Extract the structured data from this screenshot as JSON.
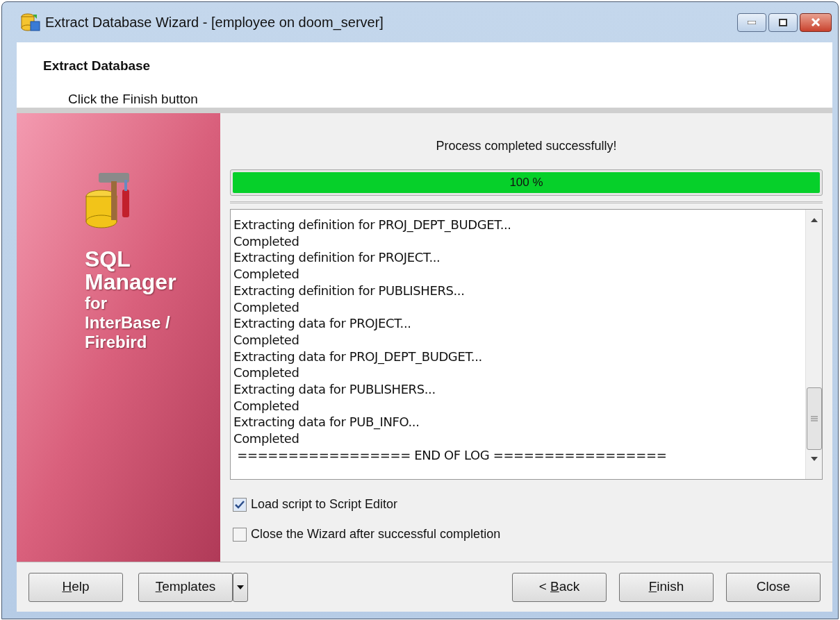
{
  "window": {
    "title": "Extract Database Wizard - [employee on doom_server]"
  },
  "header": {
    "title": "Extract Database",
    "subtitle": "Click the Finish button"
  },
  "sidebar": {
    "product": [
      "SQL",
      "Manager"
    ],
    "product_sub": [
      "for",
      "InterBase /",
      "Firebird"
    ]
  },
  "status": "Process completed successfully!",
  "progress": {
    "level": 1,
    "reading": "100 %"
  },
  "log": [
    "Extracting definition for PROJ_DEPT_BUDGET...",
    "Completed",
    "Extracting definition for PROJECT...",
    "Completed",
    "Extracting definition for PUBLISHERS...",
    "Completed",
    "Extracting data for PROJECT...",
    "Completed",
    "Extracting data for PROJ_DEPT_BUDGET...",
    "Completed",
    "Extracting data for PUBLISHERS...",
    "Completed",
    "Extracting data for PUB_INFO...",
    "Completed",
    " ================= END OF LOG ================="
  ],
  "options": [
    {
      "label": "Load script to Script Editor",
      "checked": true
    },
    {
      "label": "Close the Wizard after successful completion",
      "checked": false
    }
  ],
  "buttons_left": [
    {
      "kind": "plain",
      "key": "H",
      "after": "elp"
    },
    {
      "kind": "split",
      "key": "T",
      "after": "emplates"
    }
  ],
  "buttons_right": [
    {
      "kind": "plain",
      "before": "< ",
      "key": "B",
      "after": "ack"
    },
    {
      "kind": "plain",
      "key": "F",
      "after": "inish"
    },
    {
      "kind": "plain",
      "before": "Close"
    }
  ]
}
